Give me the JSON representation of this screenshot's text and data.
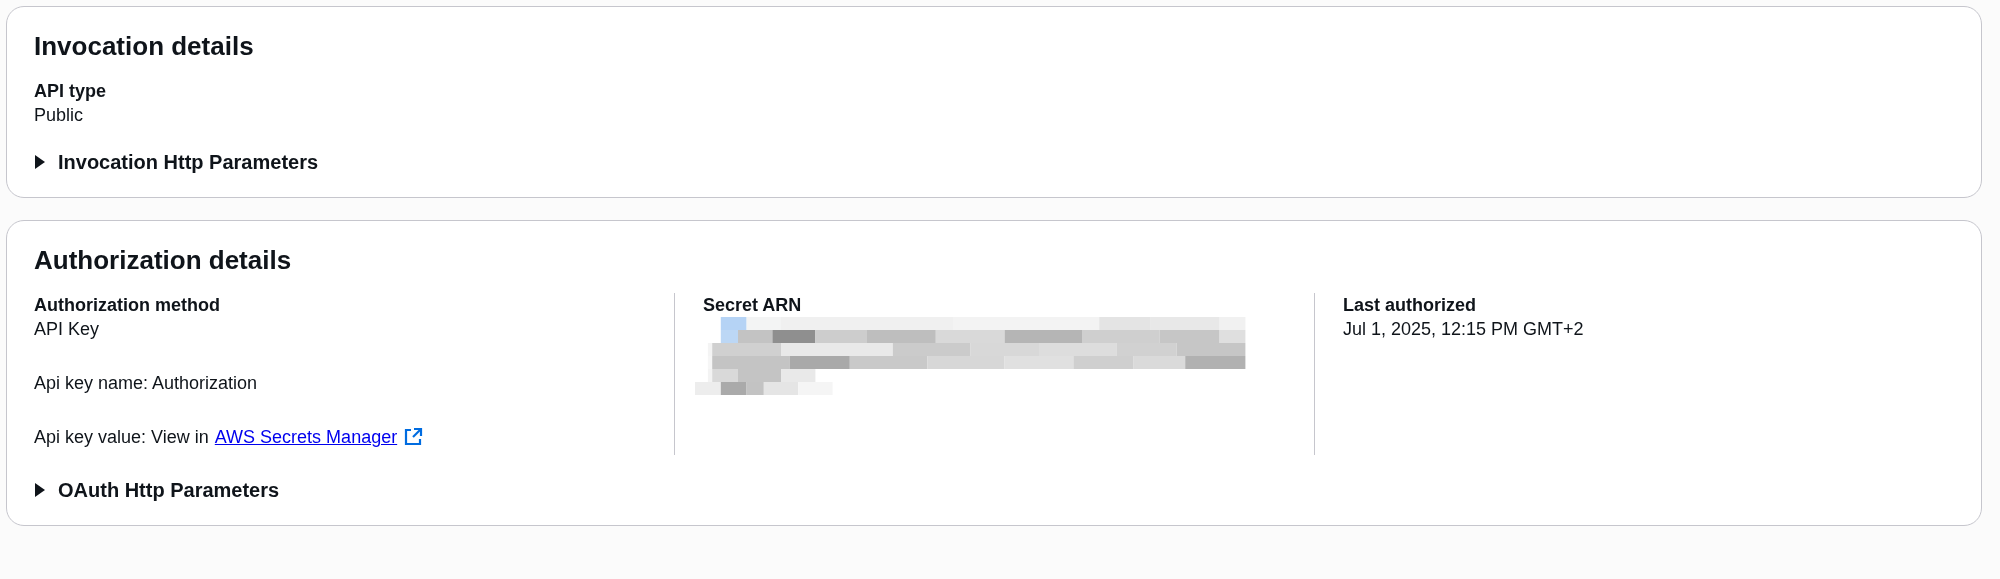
{
  "sections": [
    {
      "title": "Invocation details",
      "columns": [
        {
          "label": "API type",
          "lines": [
            {
              "kind": "text",
              "text": "Public"
            }
          ]
        }
      ],
      "expander": {
        "label": "Invocation Http Parameters",
        "expanded": false
      }
    },
    {
      "title": "Authorization details",
      "columns": [
        {
          "label": "Authorization method",
          "lines": [
            {
              "kind": "text",
              "text": "API Key"
            },
            {
              "kind": "text",
              "text": "Api key name: Authorization"
            },
            {
              "kind": "link",
              "text": "Api key value: View in",
              "link": "AWS Secrets Manager"
            }
          ]
        },
        {
          "label": "Secret ARN",
          "lines": [
            {
              "kind": "redacted"
            }
          ]
        },
        {
          "label": "Last authorized",
          "lines": [
            {
              "kind": "text",
              "text": "Jul 1, 2025, 12:15 PM GMT+2"
            }
          ]
        }
      ],
      "expander": {
        "label": "OAuth Http Parameters",
        "expanded": false
      }
    }
  ]
}
